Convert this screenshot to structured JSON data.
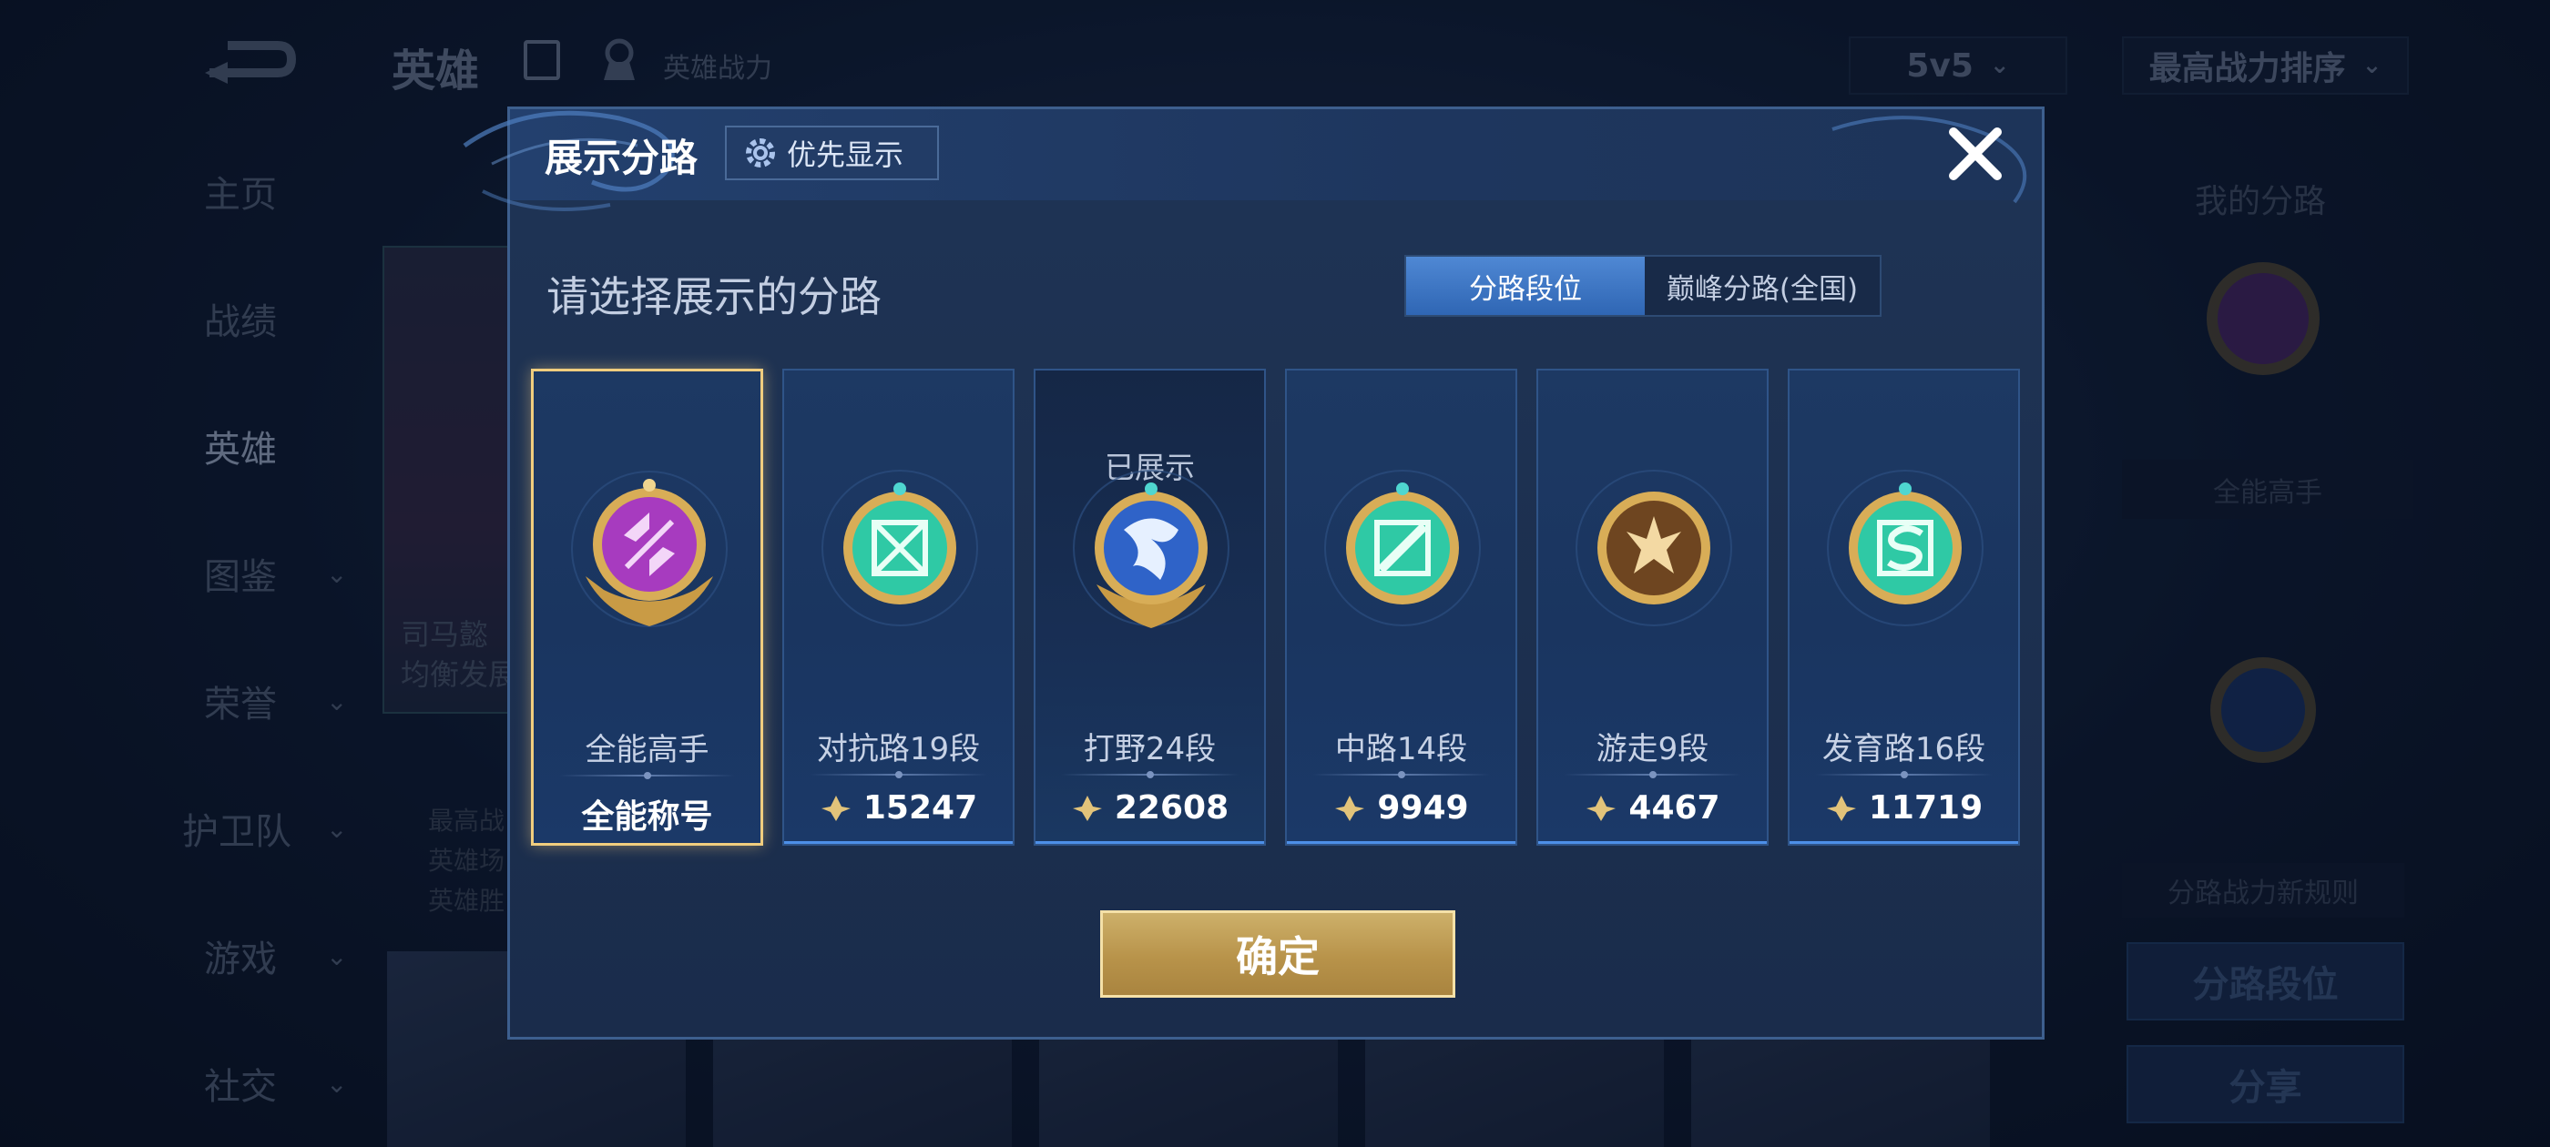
{
  "topbar": {
    "title": "英雄",
    "hero_power_label": "英雄战力",
    "mode": "5v5",
    "sort": "最高战力排序"
  },
  "sidebar": {
    "items": [
      {
        "label": "主页",
        "has_chevron": false
      },
      {
        "label": "战绩",
        "has_chevron": false
      },
      {
        "label": "英雄",
        "has_chevron": false,
        "active": true
      },
      {
        "label": "图鉴",
        "has_chevron": true
      },
      {
        "label": "荣誉",
        "has_chevron": true
      },
      {
        "label": "护卫队",
        "has_chevron": true
      },
      {
        "label": "游戏",
        "has_chevron": true
      },
      {
        "label": "社交",
        "has_chevron": true
      }
    ]
  },
  "bg_hero": {
    "name_partial": "司马懿",
    "sub_partial": "均衡发展",
    "stats_partial": [
      "最高战",
      "英雄场",
      "英雄胜"
    ]
  },
  "right_panel": {
    "title": "我的分路",
    "title_name": "全能高手",
    "rule_label": "分路战力新规则",
    "lane_rank_button": "分路段位",
    "share_button": "分享"
  },
  "modal": {
    "title": "展示分路",
    "priority_label": "优先显示",
    "subtitle": "请选择展示的分路",
    "tabs": [
      {
        "label": "分路段位",
        "active": true
      },
      {
        "label": "巅峰分路(全国)",
        "active": false
      }
    ],
    "shown_label": "已展示",
    "cards": [
      {
        "name": "全能高手",
        "value": "全能称号",
        "selected": true,
        "shown": false,
        "emblem": "all-round-emblem-icon",
        "color": "#b53cc4"
      },
      {
        "name": "对抗路19段",
        "value": "15247",
        "selected": false,
        "shown": false,
        "emblem": "clash-lane-emblem-icon",
        "color": "#2fc9a5"
      },
      {
        "name": "打野24段",
        "value": "22608",
        "selected": false,
        "shown": true,
        "emblem": "jungle-emblem-icon",
        "color": "#2f63c8"
      },
      {
        "name": "中路14段",
        "value": "9949",
        "selected": false,
        "shown": false,
        "emblem": "mid-lane-emblem-icon",
        "color": "#2fc9a5"
      },
      {
        "name": "游走9段",
        "value": "4467",
        "selected": false,
        "shown": false,
        "emblem": "roam-emblem-icon",
        "color": "#8a5a2a"
      },
      {
        "name": "发育路16段",
        "value": "11719",
        "selected": false,
        "shown": false,
        "emblem": "farm-lane-emblem-icon",
        "color": "#2fc9a5"
      }
    ],
    "confirm_label": "确定"
  }
}
